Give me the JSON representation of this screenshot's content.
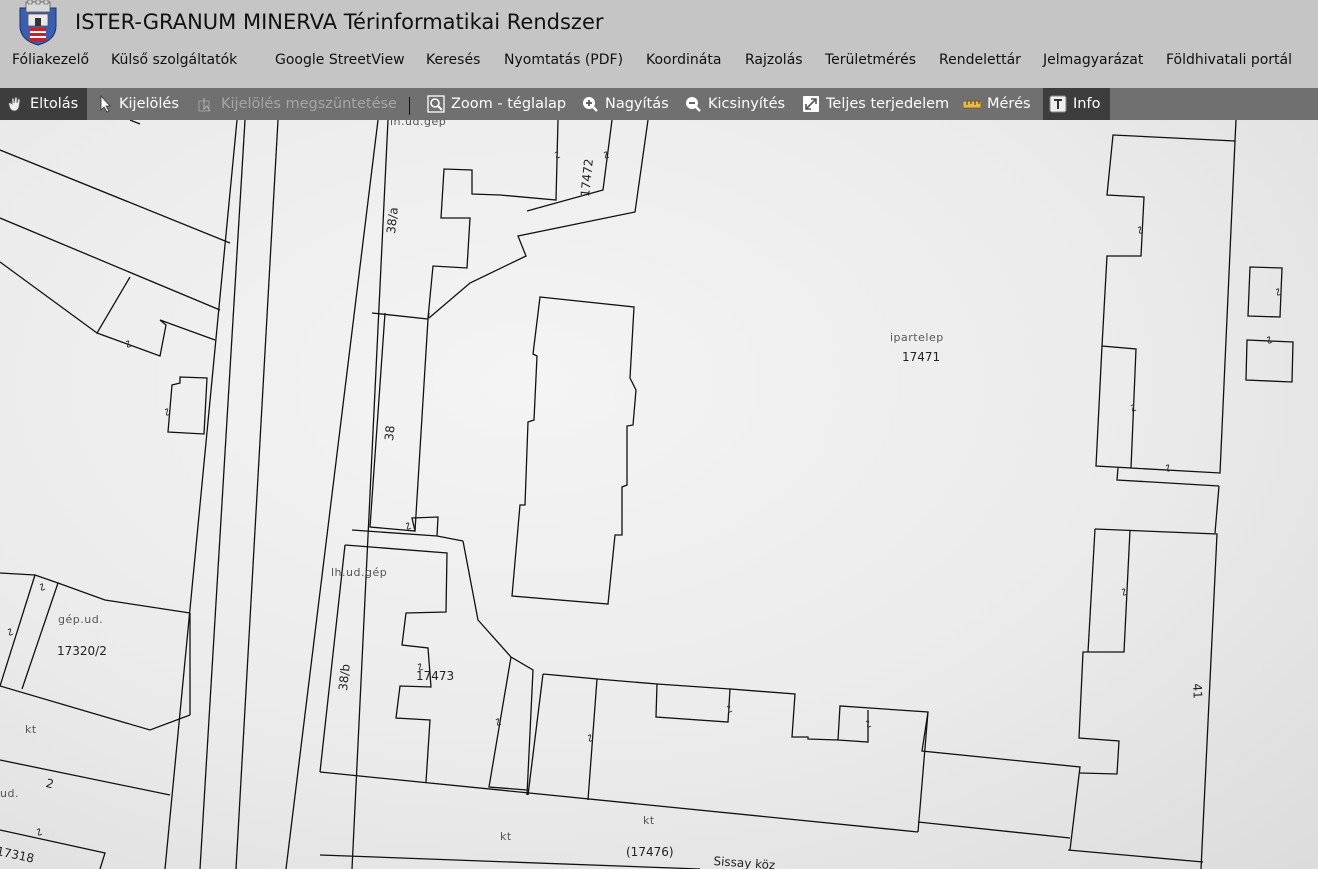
{
  "app": {
    "title": "ISTER-GRANUM MINERVA Térinformatikai Rendszer",
    "logo_icon": "coat-of-arms-icon"
  },
  "menu": [
    "Fóliakezelő",
    "Külső szolgáltatók",
    "Google StreetView",
    "Keresés",
    "Nyomtatás (PDF)",
    "Koordináta",
    "Rajzolás",
    "Területmérés",
    "Rendelettár",
    "Jelmagyarázat",
    "Földhivatali portál"
  ],
  "toolbar": {
    "pan": {
      "label": "Eltolás",
      "icon": "hand-icon",
      "active": true
    },
    "select": {
      "label": "Kijelölés",
      "icon": "pointer-icon"
    },
    "clear_selection": {
      "label": "Kijelölés megszüntetése",
      "icon": "clear-selection-icon",
      "disabled": true
    },
    "zoom_box": {
      "label": "Zoom - téglalap",
      "icon": "zoom-box-icon"
    },
    "zoom_in": {
      "label": "Nagyítás",
      "icon": "zoom-in-icon"
    },
    "zoom_out": {
      "label": "Kicsinyítés",
      "icon": "zoom-out-icon"
    },
    "full_extent": {
      "label": "Teljes terjedelem",
      "icon": "full-extent-icon"
    },
    "measure": {
      "label": "Mérés",
      "icon": "ruler-icon"
    },
    "info": {
      "label": "Info",
      "icon": "info-icon",
      "active": true
    }
  },
  "map": {
    "labels": {
      "ipartelep": "ipartelep",
      "parcel_17471": "17471",
      "parcel_17472": "17472",
      "parcel_38a": "38/a",
      "parcel_38": "38",
      "parcel_38b": "38/b",
      "parcel_17473": "17473",
      "lh_ud_gep_top": "lh.ud.gép",
      "lh_ud_gep": "lh.ud.gép",
      "gep_ud": "gép.ud.",
      "parcel_17320_2": "17320/2",
      "kt_left": "kt",
      "parcel_2": "2",
      "ud": "ud.",
      "parcel_17318": "17318",
      "kt_bottom1": "kt",
      "kt_bottom2": "kt",
      "parcel_17476": "(17476)",
      "sissay_koz": "Sissay köz",
      "parcel_41": "41"
    }
  }
}
